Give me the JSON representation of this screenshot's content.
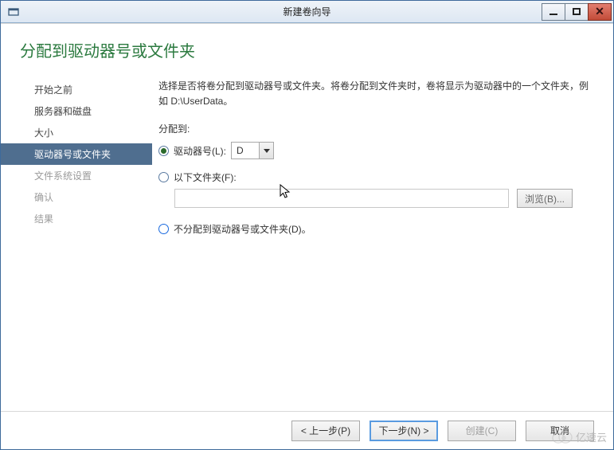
{
  "window": {
    "title": "新建卷向导"
  },
  "page": {
    "heading": "分配到驱动器号或文件夹"
  },
  "sidebar": {
    "steps": [
      {
        "label": "开始之前",
        "state": "done"
      },
      {
        "label": "服务器和磁盘",
        "state": "done"
      },
      {
        "label": "大小",
        "state": "done"
      },
      {
        "label": "驱动器号或文件夹",
        "state": "current"
      },
      {
        "label": "文件系统设置",
        "state": "future"
      },
      {
        "label": "确认",
        "state": "future"
      },
      {
        "label": "结果",
        "state": "future"
      }
    ]
  },
  "main": {
    "description": "选择是否将卷分配到驱动器号或文件夹。将卷分配到文件夹时，卷将显示为驱动器中的一个文件夹，例如 D:\\UserData。",
    "assign_label": "分配到:",
    "opt_drive": {
      "label": "驱动器号(L):",
      "selected": true,
      "value": "D"
    },
    "opt_folder": {
      "label": "以下文件夹(F):",
      "selected": false,
      "path": "",
      "browse": "浏览(B)..."
    },
    "opt_none": {
      "label": "不分配到驱动器号或文件夹(D)。",
      "selected": false
    }
  },
  "footer": {
    "prev": "< 上一步(P)",
    "next": "下一步(N) >",
    "create": "创建(C)",
    "cancel": "取消"
  },
  "watermark": "亿速云"
}
